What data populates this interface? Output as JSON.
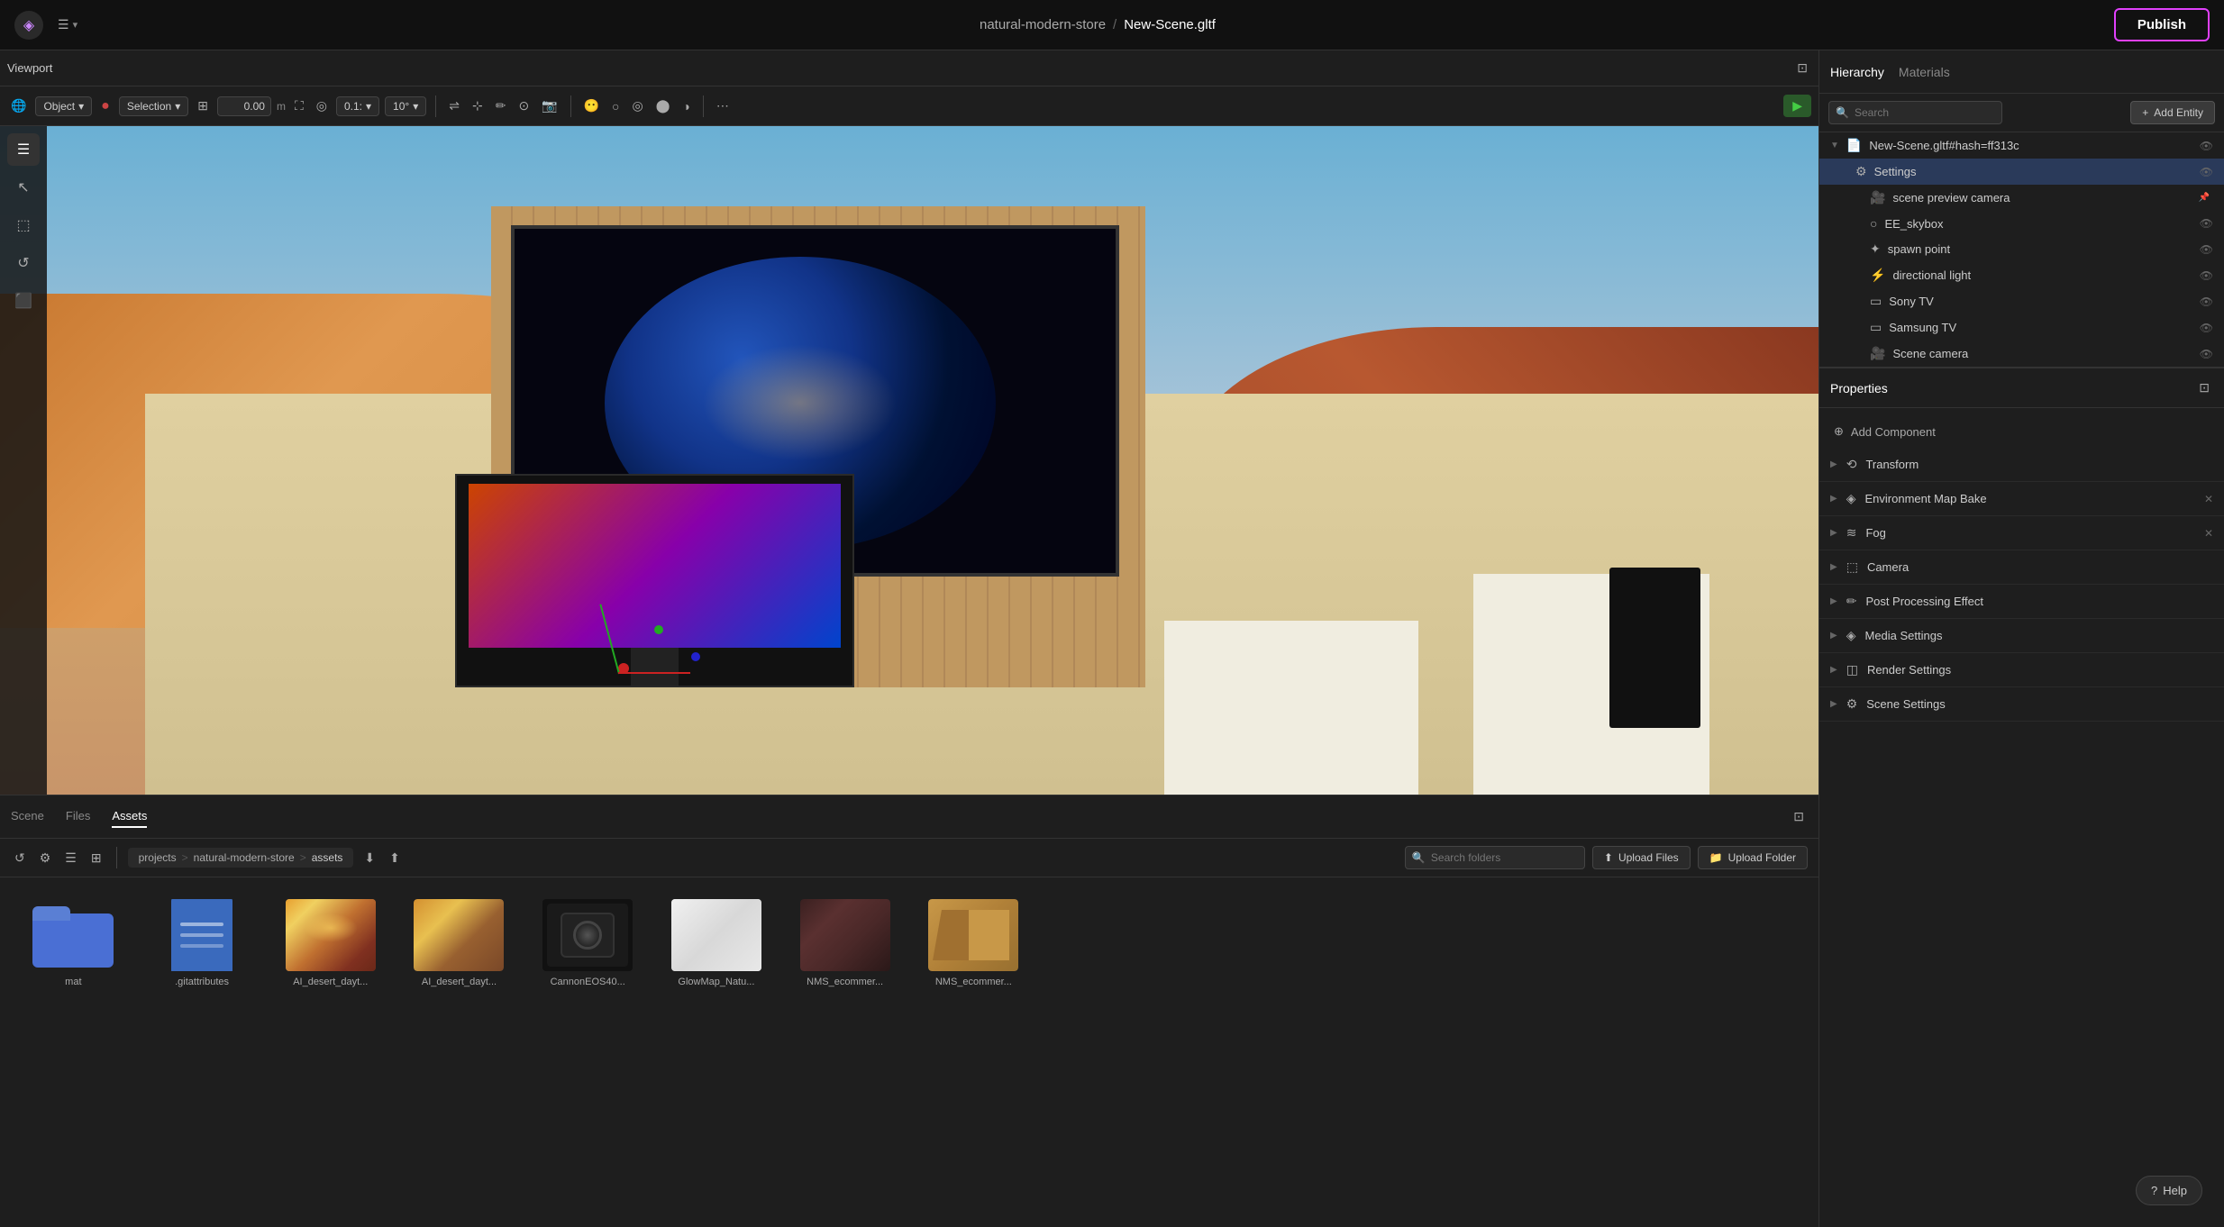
{
  "app": {
    "logo": "◈",
    "project": "natural-modern-store",
    "separator": "/",
    "scene": "New-Scene.gltf",
    "publish_label": "Publish"
  },
  "toolbar": {
    "mode_label": "Object",
    "transform_label": "Selection",
    "position_value": "0.00",
    "position_unit": "m",
    "snap_value": "0.1:",
    "angle_value": "10°",
    "play_icon": "▶"
  },
  "hierarchy": {
    "tab1": "Hierarchy",
    "tab2": "Materials",
    "search_placeholder": "Search",
    "add_entity_label": "Add Entity",
    "scene_file": "New-Scene.gltf#hash=ff313c",
    "items": [
      {
        "id": "settings",
        "name": "Settings",
        "icon": "⚙",
        "indent": 1,
        "visible": true
      },
      {
        "id": "scene-preview-camera",
        "name": "scene preview camera",
        "icon": "🎥",
        "indent": 2,
        "visible": false,
        "pinned": true
      },
      {
        "id": "ee-skybox",
        "name": "EE_skybox",
        "icon": "○",
        "indent": 2,
        "visible": true
      },
      {
        "id": "spawn-point",
        "name": "spawn point",
        "icon": "✦",
        "indent": 2,
        "visible": true
      },
      {
        "id": "directional-light",
        "name": "directional light",
        "icon": "⚡",
        "indent": 2,
        "visible": true
      },
      {
        "id": "sony-tv",
        "name": "Sony TV",
        "icon": "▭",
        "indent": 2,
        "visible": true
      },
      {
        "id": "samsung-tv",
        "name": "Samsung TV",
        "icon": "▭",
        "indent": 2,
        "visible": true
      },
      {
        "id": "scene-camera",
        "name": "Scene camera",
        "icon": "🎥",
        "indent": 2,
        "visible": true
      }
    ]
  },
  "properties": {
    "title": "Properties",
    "add_component_label": "Add Component",
    "sections": [
      {
        "id": "transform",
        "label": "Transform",
        "icon": "⟲",
        "closable": false
      },
      {
        "id": "env-map-bake",
        "label": "Environment Map Bake",
        "icon": "◈",
        "closable": true
      },
      {
        "id": "fog",
        "label": "Fog",
        "icon": "≋",
        "closable": true
      },
      {
        "id": "camera",
        "label": "Camera",
        "icon": "⬚",
        "closable": false
      },
      {
        "id": "post-processing",
        "label": "Post Processing Effect",
        "icon": "✏",
        "closable": false
      },
      {
        "id": "media-settings",
        "label": "Media Settings",
        "icon": "◈",
        "closable": false
      },
      {
        "id": "render-settings",
        "label": "Render Settings",
        "icon": "◫",
        "closable": false
      },
      {
        "id": "scene-settings",
        "label": "Scene Settings",
        "icon": "⚙",
        "closable": false
      }
    ]
  },
  "bottom_panel": {
    "tabs": [
      "Scene",
      "Files",
      "Assets"
    ],
    "active_tab": "Assets",
    "breadcrumb": [
      "projects",
      "natural-modern-store",
      "assets"
    ],
    "search_placeholder": "Search folders",
    "upload_files_label": "Upload Files",
    "upload_folder_label": "Upload Folder",
    "files": [
      {
        "id": "mat",
        "type": "folder",
        "label": "mat"
      },
      {
        "id": "gitattributes",
        "type": "doc",
        "label": ".gitattributes"
      },
      {
        "id": "ai-desert-dayt1",
        "type": "img-desert",
        "label": "AI_desert_dayt..."
      },
      {
        "id": "ai-desert-dayt2",
        "type": "img-desert2",
        "label": "AI_desert_dayt..."
      },
      {
        "id": "canon-eos40",
        "type": "img-camera",
        "label": "CannonEOS40..."
      },
      {
        "id": "glowmap-natu",
        "type": "img-white",
        "label": "GlowMap_Natu..."
      },
      {
        "id": "nms-ecommer1",
        "type": "img-dark1",
        "label": "NMS_ecommer..."
      },
      {
        "id": "nms-ecommer2",
        "type": "img-box",
        "label": "NMS_ecommer..."
      }
    ]
  },
  "help": {
    "label": "Help"
  },
  "viewport": {
    "title": "Viewport"
  }
}
